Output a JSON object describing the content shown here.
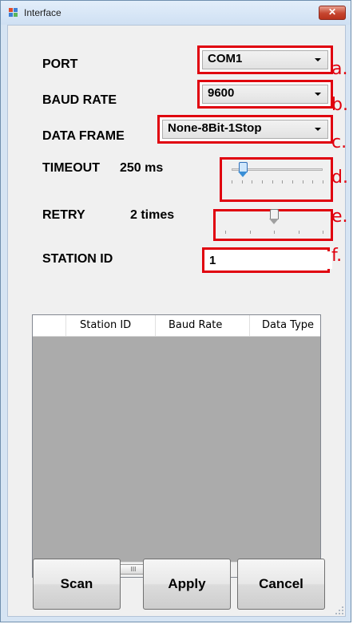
{
  "window": {
    "title": "Interface"
  },
  "icons": {
    "app": "window-app-icon",
    "close": "close-icon"
  },
  "fields": {
    "port": {
      "label": "PORT",
      "value": "COM1",
      "marker": "a."
    },
    "baud_rate": {
      "label": "BAUD RATE",
      "value": "9600",
      "marker": "b."
    },
    "data_frame": {
      "label": "DATA FRAME",
      "value": "None-8Bit-1Stop",
      "marker": "c."
    },
    "timeout": {
      "label": "TIMEOUT",
      "value_text": "250 ms",
      "slider_fraction": 0.12,
      "marker": "d."
    },
    "retry": {
      "label": "RETRY",
      "value_text": "2 times",
      "slider_fraction": 0.5,
      "marker": "e."
    },
    "station_id": {
      "label": "STATION ID",
      "value": "1",
      "marker": "f."
    }
  },
  "table": {
    "columns": [
      "",
      "Station ID",
      "Baud Rate",
      "Data Type"
    ],
    "scrollbar_grip": "III"
  },
  "buttons": {
    "scan": "Scan",
    "apply": "Apply",
    "cancel": "Cancel"
  },
  "colors": {
    "highlight": "#e0000e",
    "timeout_thumb": "#3a8fd6",
    "retry_thumb": "#a0a0a0"
  }
}
